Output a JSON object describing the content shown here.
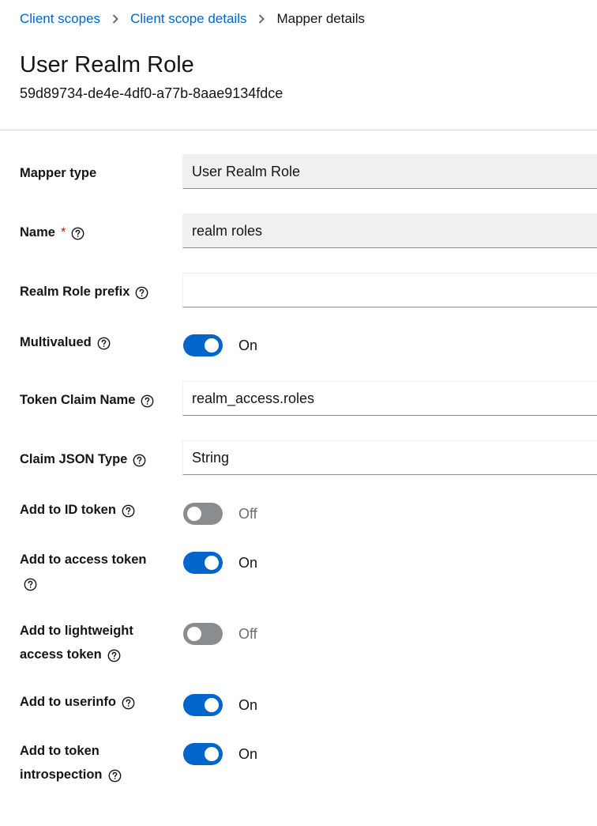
{
  "breadcrumb": {
    "items": [
      "Client scopes",
      "Client scope details"
    ],
    "current": "Mapper details"
  },
  "header": {
    "title": "User Realm Role",
    "id": "59d89734-de4e-4df0-a77b-8aae9134fdce"
  },
  "form": {
    "mapper_type": {
      "label": "Mapper type",
      "value": "User Realm Role"
    },
    "name": {
      "label": "Name",
      "required_mark": "*",
      "value": "realm roles"
    },
    "realm_role_prefix": {
      "label": "Realm Role prefix",
      "value": ""
    },
    "multivalued": {
      "label": "Multivalued",
      "state": "On"
    },
    "token_claim_name": {
      "label": "Token Claim Name",
      "value": "realm_access.roles"
    },
    "claim_json_type": {
      "label": "Claim JSON Type",
      "value": "String"
    },
    "add_to_id_token": {
      "label": "Add to ID token",
      "state": "Off"
    },
    "add_to_access_token": {
      "label": "Add to access token",
      "state": "On"
    },
    "add_to_lightweight": {
      "label_line1": "Add to lightweight",
      "label_line2": "access token",
      "state": "Off"
    },
    "add_to_userinfo": {
      "label": "Add to userinfo",
      "state": "On"
    },
    "add_to_introspection": {
      "label_line1": "Add to token",
      "label_line2": "introspection",
      "state": "On"
    }
  },
  "icons": {
    "help": "help-circle-icon",
    "separator": "chevron-right-icon"
  },
  "colors": {
    "link": "#0066cc",
    "toggle_on": "#0066cc",
    "toggle_off": "#8a8d90",
    "required": "#c9190b"
  }
}
